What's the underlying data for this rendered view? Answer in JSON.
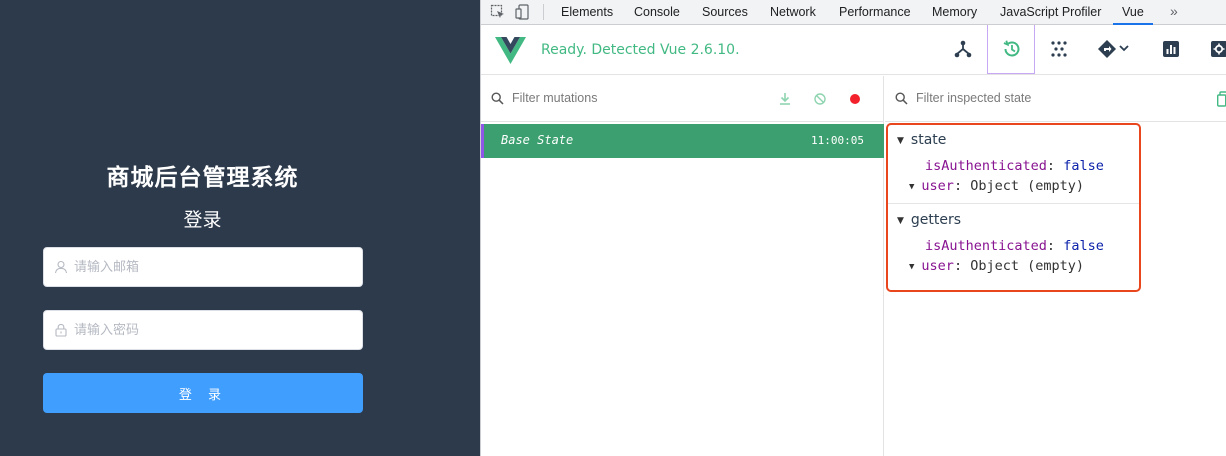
{
  "login": {
    "title": "商城后台管理系统",
    "subtitle": "登录",
    "email_placeholder": "请输入邮箱",
    "password_placeholder": "请输入密码",
    "submit_label": "登 录",
    "bg_color": "#2d3a4b",
    "button_color": "#409eff"
  },
  "devtools": {
    "tabs": [
      {
        "label": "Elements"
      },
      {
        "label": "Console"
      },
      {
        "label": "Sources"
      },
      {
        "label": "Network"
      },
      {
        "label": "Performance"
      },
      {
        "label": "Memory"
      },
      {
        "label": "JavaScript Profiler"
      },
      {
        "label": "Vue",
        "active": true
      }
    ],
    "more_label": "»",
    "vue": {
      "status": "Ready. Detected Vue 2.6.10.",
      "tools": [
        "components-icon",
        "history-icon",
        "events-icon",
        "routing-icon",
        "performance-icon",
        "settings-icon"
      ],
      "active_tool": "history-icon",
      "accent": "#42b983"
    },
    "mutations": {
      "filter_placeholder": "Filter mutations",
      "actions": [
        "download-icon",
        "clear-icon",
        "record-icon"
      ],
      "entries": [
        {
          "name": "Base State",
          "time": "11:00:05",
          "selected": true
        }
      ]
    },
    "inspector": {
      "filter_placeholder": "Filter inspected state",
      "sections": [
        {
          "title": "state",
          "items": [
            {
              "key": "isAuthenticated",
              "value": "false"
            },
            {
              "key": "user",
              "value": "Object (empty)",
              "expandable": true
            }
          ]
        },
        {
          "title": "getters",
          "items": [
            {
              "key": "isAuthenticated",
              "value": "false"
            },
            {
              "key": "user",
              "value": "Object (empty)",
              "expandable": true
            }
          ]
        }
      ],
      "highlight_color": "#e9461e"
    }
  }
}
